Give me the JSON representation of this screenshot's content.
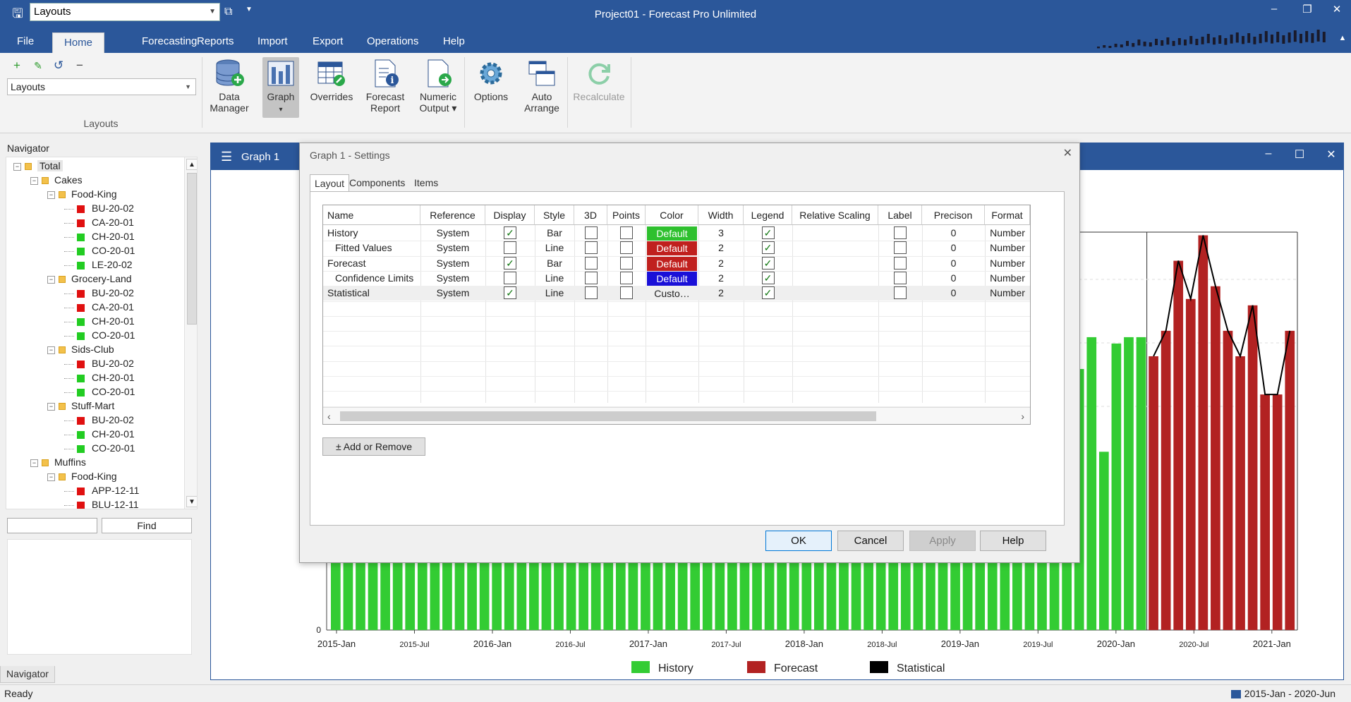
{
  "app": {
    "title": "Project01 - Forecast Pro Unlimited",
    "quick_layout": "Layouts"
  },
  "menu": {
    "tabs": [
      "File",
      "Home",
      "Forecasting",
      "Reports",
      "Import",
      "Export",
      "Operations",
      "Help"
    ],
    "active": "Home"
  },
  "ribbon": {
    "layouts_select": "Layouts",
    "group_label": "Layouts",
    "buttons": {
      "data_manager": [
        "Data",
        "Manager"
      ],
      "graph": [
        "Graph",
        "▾"
      ],
      "overrides": [
        "Overrides"
      ],
      "forecast_report": [
        "Forecast",
        "Report"
      ],
      "numeric_output": [
        "Numeric",
        "Output ▾"
      ],
      "options": [
        "Options"
      ],
      "auto_arrange": [
        "Auto",
        "Arrange"
      ],
      "recalculate": [
        "Recalculate"
      ]
    }
  },
  "navigator": {
    "title": "Navigator",
    "find_label": "Find",
    "tab_label": "Navigator",
    "tree": [
      {
        "label": "Total",
        "level": 0,
        "type": "folder",
        "expander": "−"
      },
      {
        "label": "Cakes",
        "level": 1,
        "type": "folder",
        "expander": "−"
      },
      {
        "label": "Food-King",
        "level": 2,
        "type": "folder",
        "expander": "−"
      },
      {
        "label": "BU-20-02",
        "level": 3,
        "type": "leaf",
        "color": "red"
      },
      {
        "label": "CA-20-01",
        "level": 3,
        "type": "leaf",
        "color": "red"
      },
      {
        "label": "CH-20-01",
        "level": 3,
        "type": "leaf",
        "color": "green"
      },
      {
        "label": "CO-20-01",
        "level": 3,
        "type": "leaf",
        "color": "green"
      },
      {
        "label": "LE-20-02",
        "level": 3,
        "type": "leaf",
        "color": "green"
      },
      {
        "label": "Grocery-Land",
        "level": 2,
        "type": "folder",
        "expander": "−"
      },
      {
        "label": "BU-20-02",
        "level": 3,
        "type": "leaf",
        "color": "red"
      },
      {
        "label": "CA-20-01",
        "level": 3,
        "type": "leaf",
        "color": "red"
      },
      {
        "label": "CH-20-01",
        "level": 3,
        "type": "leaf",
        "color": "green"
      },
      {
        "label": "CO-20-01",
        "level": 3,
        "type": "leaf",
        "color": "green"
      },
      {
        "label": "Sids-Club",
        "level": 2,
        "type": "folder",
        "expander": "−"
      },
      {
        "label": "BU-20-02",
        "level": 3,
        "type": "leaf",
        "color": "red"
      },
      {
        "label": "CH-20-01",
        "level": 3,
        "type": "leaf",
        "color": "green"
      },
      {
        "label": "CO-20-01",
        "level": 3,
        "type": "leaf",
        "color": "green"
      },
      {
        "label": "Stuff-Mart",
        "level": 2,
        "type": "folder",
        "expander": "−"
      },
      {
        "label": "BU-20-02",
        "level": 3,
        "type": "leaf",
        "color": "red"
      },
      {
        "label": "CH-20-01",
        "level": 3,
        "type": "leaf",
        "color": "green"
      },
      {
        "label": "CO-20-01",
        "level": 3,
        "type": "leaf",
        "color": "green"
      },
      {
        "label": "Muffins",
        "level": 1,
        "type": "folder",
        "expander": "−"
      },
      {
        "label": "Food-King",
        "level": 2,
        "type": "folder",
        "expander": "−"
      },
      {
        "label": "APP-12-11",
        "level": 3,
        "type": "leaf",
        "color": "red"
      },
      {
        "label": "BLU-12-11",
        "level": 3,
        "type": "leaf",
        "color": "red"
      }
    ]
  },
  "status": {
    "text": "Ready",
    "date_range": "2015-Jan - 2020-Jun"
  },
  "graph_window": {
    "title": "Graph 1"
  },
  "chart_data": {
    "type": "bar",
    "x_tick_labels": [
      "2015-Jan",
      "2015-Jul",
      "2016-Jan",
      "2016-Jul",
      "2017-Jan",
      "2017-Jul",
      "2018-Jan",
      "2018-Jul",
      "2019-Jan",
      "2019-Jul",
      "2020-Jan",
      "2020-Jul",
      "2021-Jan"
    ],
    "y_tick_labels": [
      "0"
    ],
    "legend": [
      "History",
      "Forecast",
      "Statistical"
    ],
    "legend_position": "bottom",
    "colors": {
      "history": "#33cc33",
      "forecast": "#b22222",
      "statistical": "#000000"
    },
    "history_tail": [
      0.53,
      0.49,
      0.41,
      0.3,
      0.41,
      0.46,
      0.28,
      0.45,
      0.46,
      0.46
    ],
    "forecast": [
      0.43,
      0.47,
      0.58,
      0.52,
      0.62,
      0.54,
      0.47,
      0.43,
      0.51,
      0.37,
      0.37,
      0.47
    ],
    "statistical": [
      0.43,
      0.47,
      0.58,
      0.52,
      0.62,
      0.54,
      0.47,
      0.43,
      0.51,
      0.37,
      0.37,
      0.47
    ]
  },
  "dialog": {
    "title": "Graph 1 - Settings",
    "tabs": [
      "Layout",
      "Components",
      "Items"
    ],
    "active_tab": "Layout",
    "columns": [
      "Name",
      "Reference",
      "Display",
      "Style",
      "3D",
      "Points",
      "Color",
      "Width",
      "Legend",
      "Relative Scaling",
      "Label",
      "Precison",
      "Format"
    ],
    "rows": [
      {
        "name": "History",
        "indent": false,
        "reference": "System",
        "display": true,
        "style": "Bar",
        "d3": false,
        "points": false,
        "color": "Default",
        "color_hex": "#2ec02e",
        "width": "3",
        "legend": true,
        "relative_scaling": "",
        "label": false,
        "precision": "0",
        "format": "Number"
      },
      {
        "name": "Fitted Values",
        "indent": true,
        "reference": "System",
        "display": false,
        "style": "Line",
        "d3": false,
        "points": false,
        "color": "Default",
        "color_hex": "#c0201e",
        "width": "2",
        "legend": true,
        "relative_scaling": "",
        "label": false,
        "precision": "0",
        "format": "Number"
      },
      {
        "name": "Forecast",
        "indent": false,
        "reference": "System",
        "display": true,
        "style": "Bar",
        "d3": false,
        "points": false,
        "color": "Default",
        "color_hex": "#c0201e",
        "width": "2",
        "legend": true,
        "relative_scaling": "",
        "label": false,
        "precision": "0",
        "format": "Number"
      },
      {
        "name": "Confidence Limits",
        "indent": true,
        "reference": "System",
        "display": false,
        "style": "Line",
        "d3": false,
        "points": false,
        "color": "Default",
        "color_hex": "#1a10d8",
        "width": "2",
        "legend": true,
        "relative_scaling": "",
        "label": false,
        "precision": "0",
        "format": "Number"
      },
      {
        "name": "Statistical",
        "indent": false,
        "reference": "System",
        "display": true,
        "style": "Line",
        "d3": false,
        "points": false,
        "color": "Custo…",
        "color_hex": "",
        "width": "2",
        "legend": true,
        "relative_scaling": "",
        "label": false,
        "precision": "0",
        "format": "Number"
      }
    ],
    "add_remove_label": "± Add or Remove",
    "buttons": {
      "ok": "OK",
      "cancel": "Cancel",
      "apply": "Apply",
      "help": "Help"
    }
  }
}
